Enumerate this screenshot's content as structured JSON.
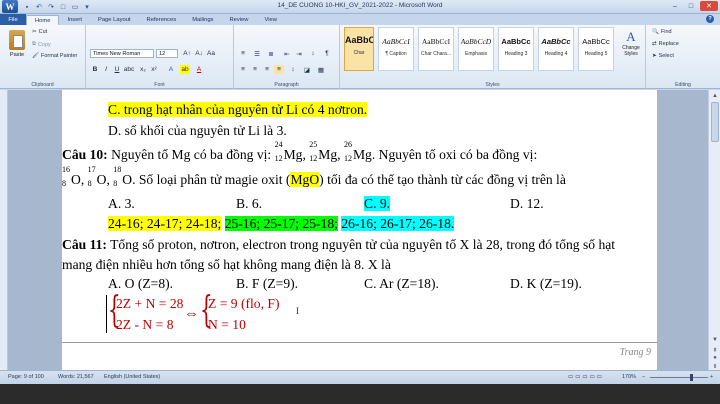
{
  "titlebar": {
    "app_icon": "W",
    "title": "14_DE CUONG 10-HKI_GV_2021-2022 - Microsoft Word",
    "qat": [
      "save-icon",
      "undo-icon",
      "redo-icon",
      "new-icon",
      "open-icon"
    ],
    "minimize": "–",
    "maximize": "□",
    "close": "✕"
  },
  "tabs": [
    "File",
    "Home",
    "Insert",
    "Page Layout",
    "References",
    "Mailings",
    "Review",
    "View"
  ],
  "help": "?",
  "ribbon": {
    "clipboard": {
      "label": "Clipboard",
      "paste": "Paste",
      "cut": "Cut",
      "copy": "Copy",
      "format_painter": "Format Painter"
    },
    "font": {
      "label": "Font",
      "family": "Times New Roman",
      "size": "12",
      "bold": "B",
      "italic": "I",
      "underline": "U"
    },
    "paragraph": {
      "label": "Paragraph"
    },
    "styles": {
      "label": "Styles",
      "items": [
        {
          "preview": "AaBbC",
          "name": "Char"
        },
        {
          "preview": "AaBbCcI",
          "name": "¶ Caption"
        },
        {
          "preview": "AaBbCcI",
          "name": "Char Chara..."
        },
        {
          "preview": "AaBbCcD",
          "name": "Emphasis"
        },
        {
          "preview": "AaBbCc",
          "name": "Heading 3"
        },
        {
          "preview": "AaBbCc",
          "name": "Heading 4"
        },
        {
          "preview": "AaBbCc",
          "name": "Heading 5"
        }
      ],
      "change_styles": "Change Styles"
    },
    "editing": {
      "label": "Editing",
      "find": "Find",
      "replace": "Replace",
      "select": "Select"
    }
  },
  "document": {
    "l1": "C. trong hạt nhân của nguyên tử Li có 4 nơtron.",
    "l2": "D. số khối của nguyên tử Li là 3.",
    "q10_label": "Câu 10:",
    "q10_text": " Nguyên tố Mg có ba đồng vị: ",
    "mg_iso": [
      {
        "mass": "24",
        "z": "12",
        "sym": "Mg"
      },
      {
        "mass": "25",
        "z": "12",
        "sym": "Mg"
      },
      {
        "mass": "26",
        "z": "12",
        "sym": "Mg"
      }
    ],
    "q10_tail": ". Nguyên tố oxi có ba đồng vị:",
    "o_iso": [
      {
        "mass": "16",
        "z": "8",
        "sym": "O"
      },
      {
        "mass": "17",
        "z": "8",
        "sym": "O"
      },
      {
        "mass": "18",
        "z": "8",
        "sym": "O"
      }
    ],
    "q10_line2": ". Số loại phân tử magie oxit (",
    "mgo": "MgO",
    "q10_line2b": ") tối đa có thể tạo thành từ các đồng vị trên là",
    "q10_a": "A. 3.",
    "q10_b": "B. 6.",
    "q10_c": "C. 9.",
    "q10_d": "D. 12.",
    "combos": {
      "yellow": "24-16; 24-17; 24-18;",
      "green": "25-16; 25-17; 25-18;",
      "cyan": "26-16; 26-17; 26-18."
    },
    "q11_label": "Câu 11:",
    "q11_text": " Tổng số proton, nơtron, electron trong nguyên tử của nguyên tố X là 28, trong đó tổng số hạt",
    "q11_line2": "mang điện nhiều hơn tổng số hạt không mang điện là 8. X là",
    "q11_a": "A. O (Z=8).",
    "q11_b": "B. F (Z=9).",
    "q11_c": "C. Ar (Z=18).",
    "q11_d": "D. K (Z=19).",
    "eq1": "2Z + N = 28",
    "eq2": "2Z - N = 8",
    "arrow": "⇔",
    "res1": "Z = 9 (flo, F)",
    "res2": "N = 10",
    "footer": "Trang 9"
  },
  "status": {
    "page": "Page: 9 of 100",
    "words": "Words: 21,567",
    "language": "English (United States)",
    "zoom": "170%"
  }
}
